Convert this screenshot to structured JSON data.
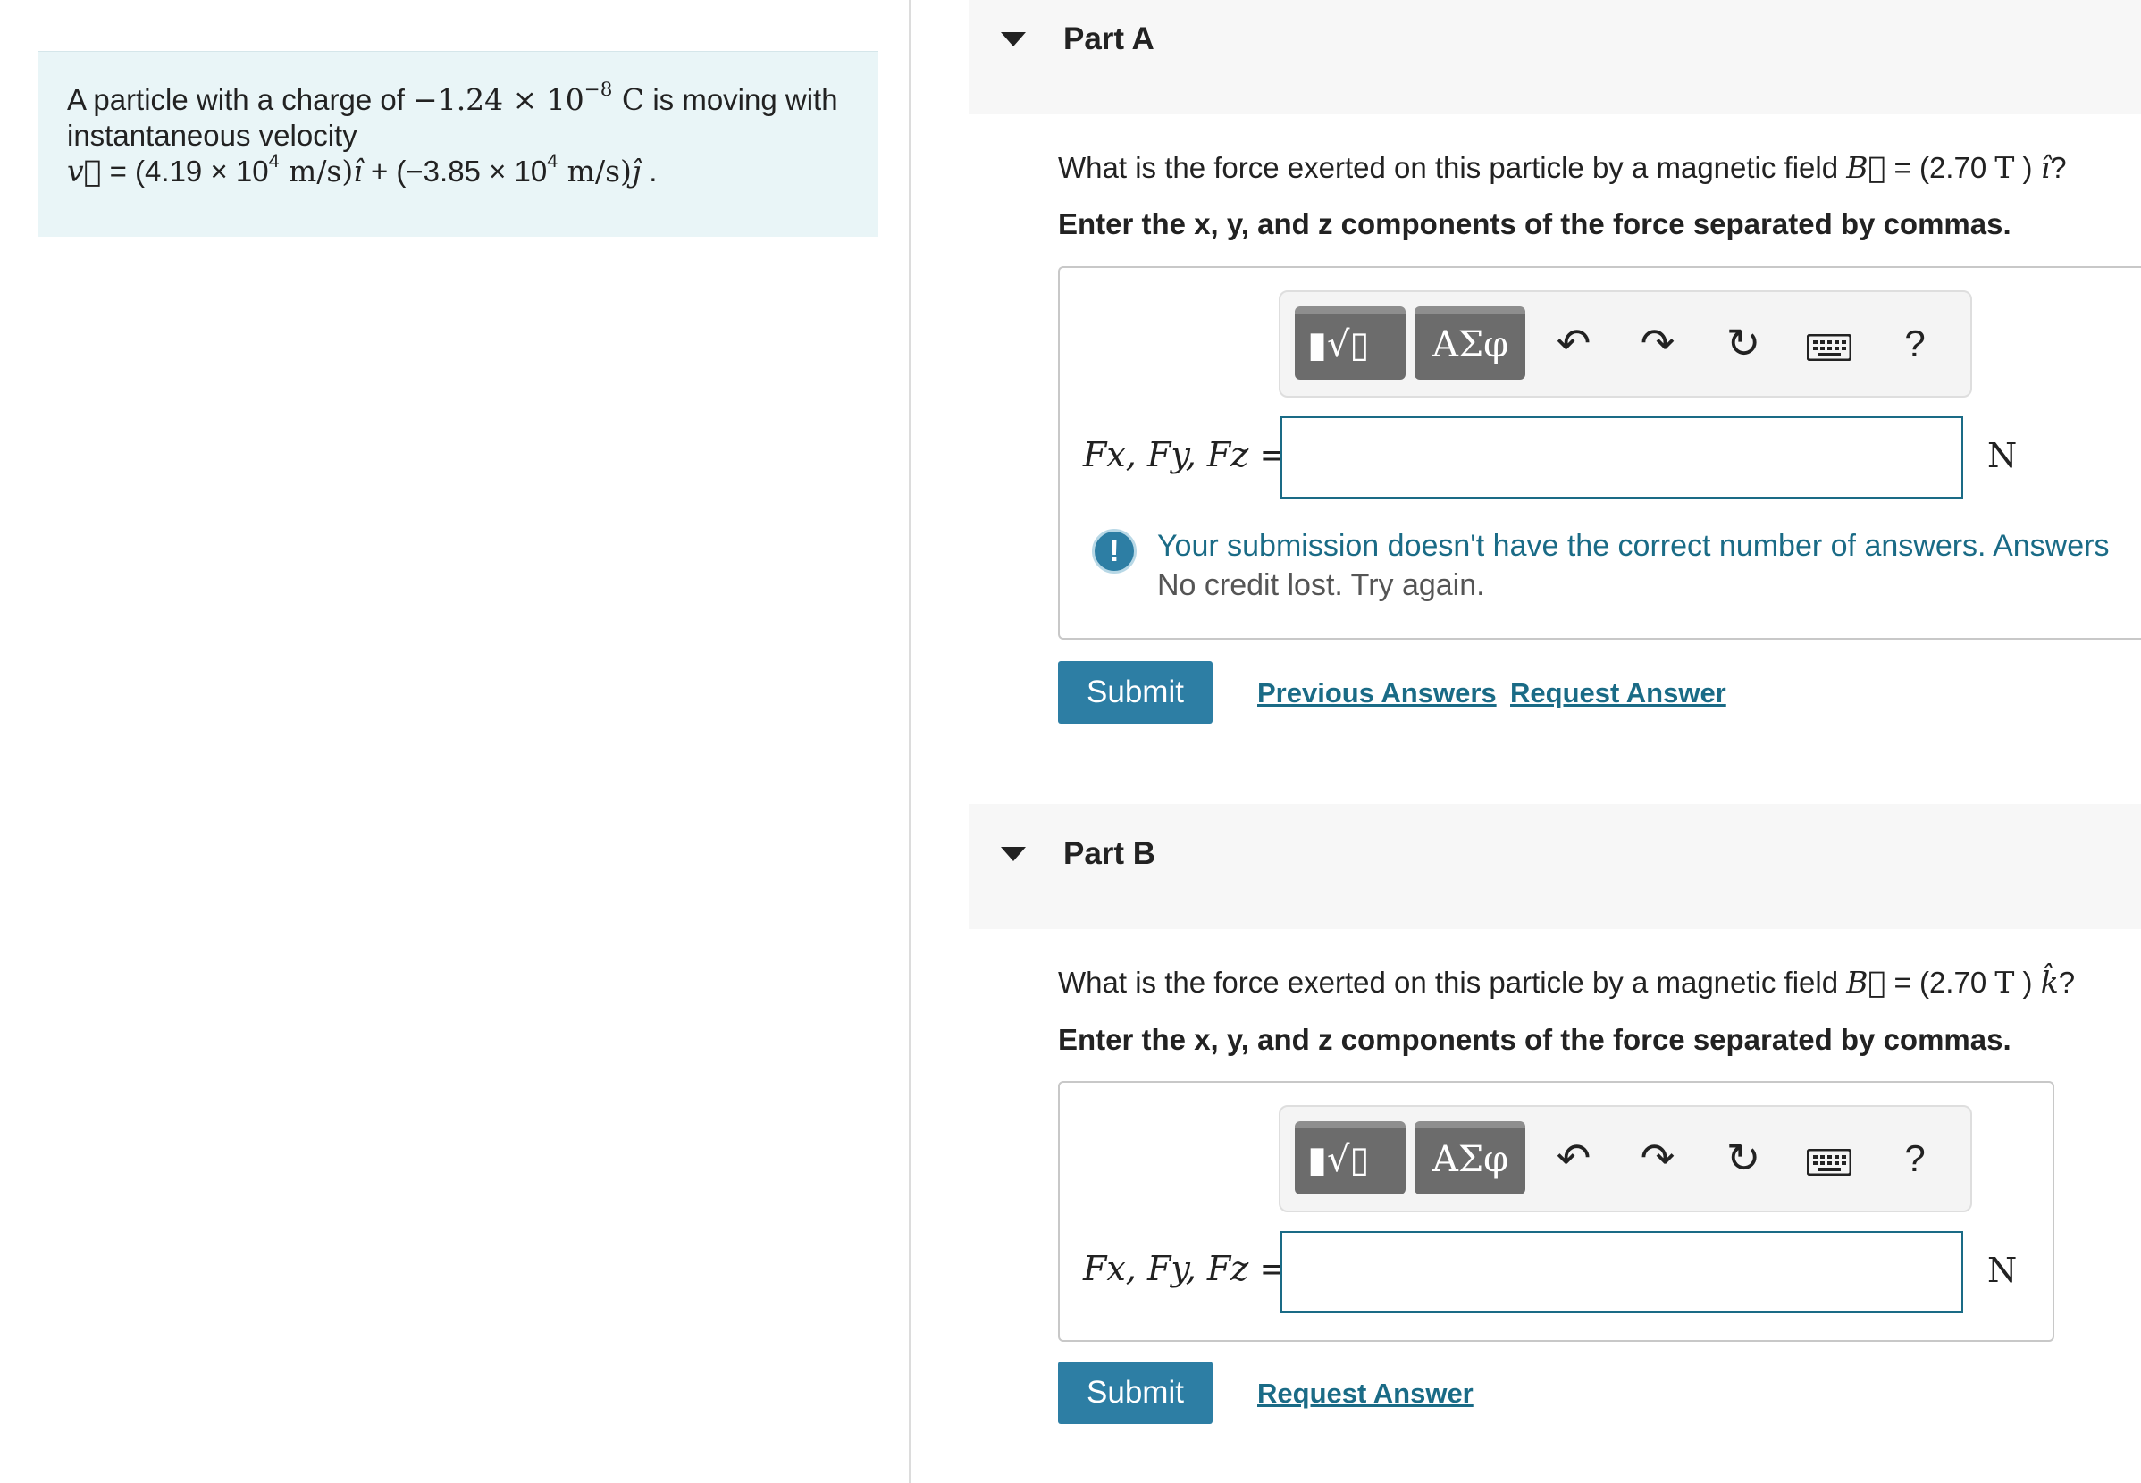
{
  "problem": {
    "text_prefix": "A particle with a charge of ",
    "charge_value": "−1.24 × 10",
    "charge_exp": "−8",
    "charge_unit": " C",
    "text_suffix": " is moving with instantaneous velocity",
    "v_symbol": "v⃗",
    "v_eq": " = (4.19 × 10",
    "v_exp1": "4",
    "v_unit1": " m/s)",
    "i_hat": "î",
    "v_mid": " + (−3.85 × 10",
    "v_exp2": "4",
    "v_unit2": " m/s)",
    "j_hat": "ĵ",
    "v_end": " ."
  },
  "parts": [
    {
      "title": "Part A",
      "question_prefix": "What is the force exerted on this particle by a magnetic field ",
      "b_symbol": "B⃗",
      "question_eq": " = (2.70 ",
      "question_unit": "T",
      "question_close": " ) ",
      "question_hat": "î",
      "question_end": "?",
      "instruction": "Enter the x, y, and z components of the force separated by commas.",
      "input_label": "Fx, Fy, Fz =",
      "input_value": "",
      "unit": "N",
      "feedback_main": "Your submission doesn't have the correct number of answers. Answers",
      "feedback_sub": "No credit lost. Try again.",
      "submit_label": "Submit",
      "previous_answers_label": "Previous Answers",
      "request_answer_label": "Request Answer"
    },
    {
      "title": "Part B",
      "question_prefix": "What is the force exerted on this particle by a magnetic field ",
      "b_symbol": "B⃗",
      "question_eq": " = (2.70 ",
      "question_unit": "T",
      "question_close": " ) ",
      "question_hat": "k̂",
      "question_end": "?",
      "instruction": "Enter the x, y, and z components of the force separated by commas.",
      "input_label": "Fx, Fy, Fz =",
      "input_value": "",
      "unit": "N",
      "submit_label": "Submit",
      "request_answer_label": "Request Answer"
    }
  ],
  "toolbar": {
    "templates_label": "▮√▯",
    "greek_label": "ΑΣφ",
    "undo_icon": "undo-icon",
    "redo_icon": "redo-icon",
    "reset_icon": "reset-icon",
    "keyboard_icon": "keyboard-icon",
    "help_label": "?"
  },
  "colors": {
    "accent": "#2d7ea4",
    "link": "#1a6b86",
    "problem_bg": "#e9f5f7",
    "part_header_bg": "#f7f7f7"
  }
}
